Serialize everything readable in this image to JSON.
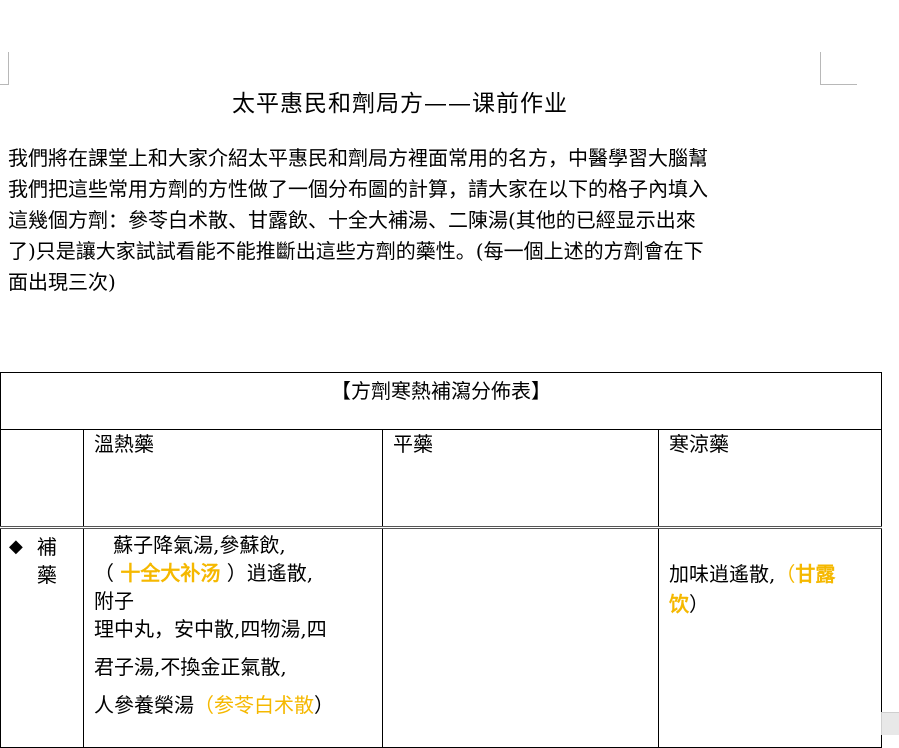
{
  "document": {
    "title": "太平惠民和劑局方——课前作业",
    "intro_lines": [
      "我們將在課堂上和大家介紹太平惠民和劑局方裡面常用的名方，中醫學習大腦幫",
      "我們把這些常用方劑的方性做了一個分布圖的計算，請大家在以下的格子內填入",
      "這幾個方劑：參苓白术散、甘露飲、十全大補湯、二陳湯(其他的已經显示出來",
      "了)只是讓大家試試看能不能推斷出這些方劑的藥性。(每一個上述的方劑會在下",
      "面出現三次)"
    ]
  },
  "table": {
    "caption": "【方劑寒熱補瀉分佈表】",
    "headers": {
      "warm": "溫熱藥",
      "neutral": "平藥",
      "cold": "寒涼藥"
    },
    "row_tonic": {
      "marker": "◆",
      "label_1": "補",
      "label_2": "藥",
      "warm": {
        "l1": "蘇子降氣湯,參蘇飲,",
        "l2_open": "（",
        "l2_fill": "十全大补汤",
        "l2_close": "）逍遙散,",
        "l3": "附子",
        "l4": "理中丸，安中散,四物湯,四",
        "l5": "君子湯,不換金正氣散,",
        "l6_text": "人參養榮湯",
        "l6_open": "（",
        "l6_fill": "参苓白术散",
        "l6_close": "）"
      },
      "cold": {
        "text": "加味逍遙散,",
        "open": "（",
        "fill_1": "甘露",
        "fill_2": "饮",
        "close": "）"
      }
    }
  },
  "colors": {
    "answer_fill": "#f5b800"
  }
}
